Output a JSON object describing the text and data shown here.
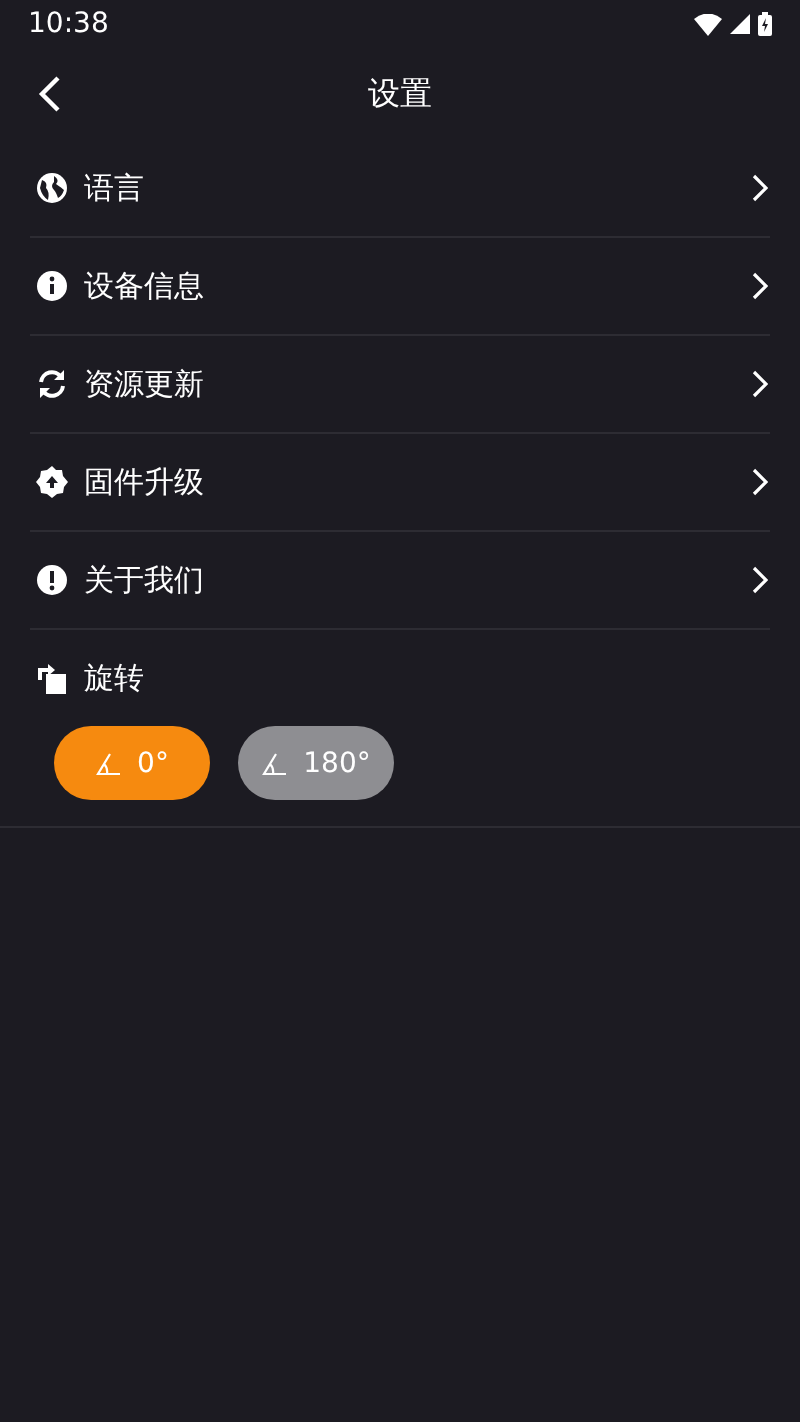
{
  "status_bar": {
    "time": "10:38"
  },
  "header": {
    "title": "设置"
  },
  "menu": [
    {
      "label": "语言",
      "kind": "globe"
    },
    {
      "label": "设备信息",
      "kind": "info"
    },
    {
      "label": "资源更新",
      "kind": "refresh"
    },
    {
      "label": "固件升级",
      "kind": "upgrade"
    },
    {
      "label": "关于我们",
      "kind": "alert"
    }
  ],
  "rotation": {
    "label": "旋转",
    "options": [
      {
        "label": "0°",
        "selected": true
      },
      {
        "label": "180°",
        "selected": false
      }
    ]
  }
}
